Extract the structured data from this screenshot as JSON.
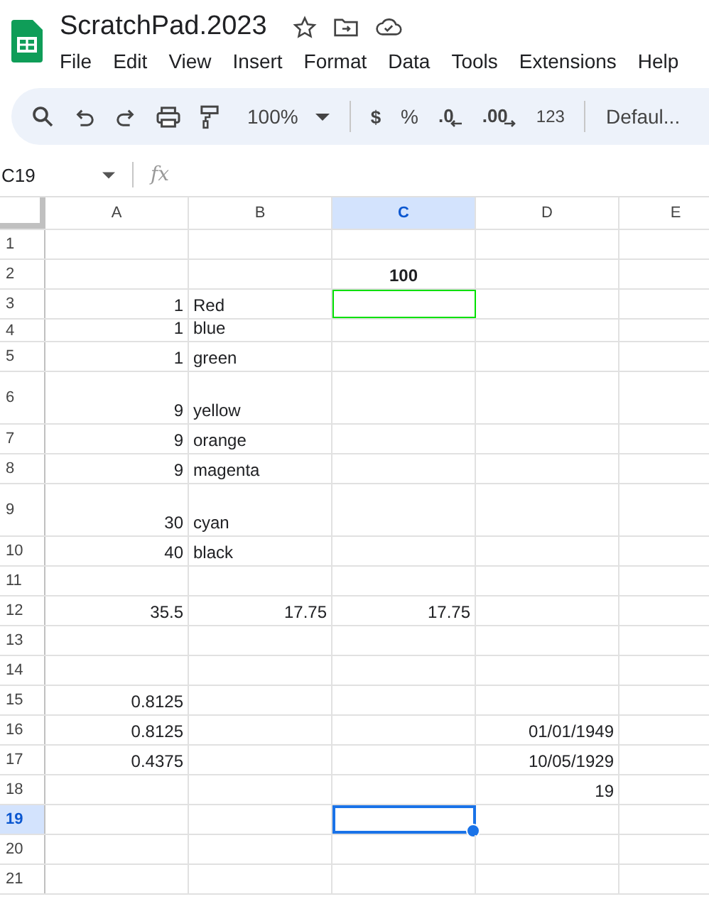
{
  "document": {
    "title": "ScratchPad.2023"
  },
  "menu": [
    "File",
    "Edit",
    "View",
    "Insert",
    "Format",
    "Data",
    "Tools",
    "Extensions",
    "Help"
  ],
  "toolbar": {
    "zoom": "100%",
    "currency": "$",
    "percent": "%",
    "decrease_decimal": ".0",
    "increase_decimal": ".00",
    "number_format": "123",
    "font": "Defaul..."
  },
  "formula_bar": {
    "cell_ref": "C19",
    "fx": "fx"
  },
  "columns": [
    {
      "label": "A",
      "selected": false
    },
    {
      "label": "B",
      "selected": false
    },
    {
      "label": "C",
      "selected": true
    },
    {
      "label": "D",
      "selected": false
    },
    {
      "label": "E",
      "selected": false
    }
  ],
  "rows": [
    {
      "label": "1",
      "selected": false,
      "cells": [
        {},
        {},
        {},
        {},
        {}
      ]
    },
    {
      "label": "2",
      "selected": false,
      "cells": [
        {},
        {},
        {
          "kind": "heading",
          "text": "100"
        },
        {},
        {}
      ]
    },
    {
      "label": "3",
      "selected": false,
      "cells": [
        {
          "kind": "number",
          "text": "1"
        },
        {
          "kind": "text",
          "text": "Red"
        },
        {
          "highlighted": true
        },
        {},
        {}
      ]
    },
    {
      "label": "4",
      "selected": false,
      "cells": [
        {
          "kind": "number",
          "text": "1"
        },
        {
          "kind": "text",
          "text": "blue"
        },
        {},
        {},
        {}
      ]
    },
    {
      "label": "5",
      "selected": false,
      "cells": [
        {
          "kind": "number",
          "text": "1"
        },
        {
          "kind": "text",
          "text": "green"
        },
        {},
        {},
        {}
      ]
    },
    {
      "label": "6",
      "selected": false,
      "cells": [
        {
          "kind": "number",
          "text": "9"
        },
        {
          "kind": "text",
          "text": "yellow"
        },
        {},
        {},
        {}
      ]
    },
    {
      "label": "7",
      "selected": false,
      "cells": [
        {
          "kind": "number",
          "text": "9"
        },
        {
          "kind": "text",
          "text": "orange"
        },
        {},
        {},
        {}
      ]
    },
    {
      "label": "8",
      "selected": false,
      "cells": [
        {
          "kind": "number",
          "text": "9"
        },
        {
          "kind": "text",
          "text": "magenta"
        },
        {},
        {},
        {}
      ]
    },
    {
      "label": "9",
      "selected": false,
      "cells": [
        {
          "kind": "number",
          "text": "30"
        },
        {
          "kind": "text",
          "text": "cyan"
        },
        {},
        {},
        {}
      ]
    },
    {
      "label": "10",
      "selected": false,
      "cells": [
        {
          "kind": "number",
          "text": "40"
        },
        {
          "kind": "text",
          "text": "black"
        },
        {},
        {},
        {}
      ]
    },
    {
      "label": "11",
      "selected": false,
      "cells": [
        {},
        {},
        {},
        {},
        {}
      ]
    },
    {
      "label": "12",
      "selected": false,
      "cells": [
        {
          "kind": "number",
          "text": "35.5"
        },
        {
          "kind": "number",
          "text": "17.75"
        },
        {
          "kind": "number",
          "text": "17.75"
        },
        {},
        {}
      ]
    },
    {
      "label": "13",
      "selected": false,
      "cells": [
        {},
        {},
        {},
        {},
        {}
      ]
    },
    {
      "label": "14",
      "selected": false,
      "cells": [
        {},
        {},
        {},
        {},
        {}
      ]
    },
    {
      "label": "15",
      "selected": false,
      "cells": [
        {
          "kind": "number",
          "text": "0.8125"
        },
        {},
        {},
        {},
        {}
      ]
    },
    {
      "label": "16",
      "selected": false,
      "cells": [
        {
          "kind": "number",
          "text": "0.8125"
        },
        {},
        {},
        {
          "kind": "number",
          "text": "01/01/1949"
        },
        {}
      ]
    },
    {
      "label": "17",
      "selected": false,
      "cells": [
        {
          "kind": "number",
          "text": "0.4375"
        },
        {},
        {},
        {
          "kind": "number",
          "text": "10/05/1929"
        },
        {}
      ]
    },
    {
      "label": "18",
      "selected": false,
      "cells": [
        {},
        {},
        {},
        {
          "kind": "number",
          "text": "19"
        },
        {}
      ]
    },
    {
      "label": "19",
      "selected": true,
      "cells": [
        {},
        {},
        {
          "selected": true
        },
        {},
        {}
      ]
    },
    {
      "label": "20",
      "selected": false,
      "cells": [
        {},
        {},
        {},
        {},
        {}
      ]
    },
    {
      "label": "21",
      "selected": false,
      "cells": [
        {},
        {},
        {},
        {},
        {}
      ]
    }
  ]
}
